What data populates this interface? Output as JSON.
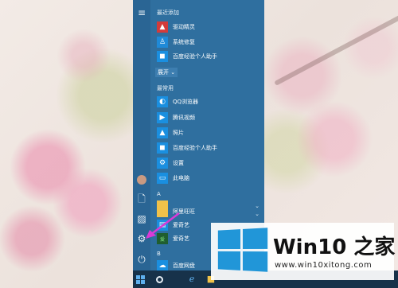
{
  "start_menu": {
    "recent_header": "最近添加",
    "recent_apps": [
      {
        "label": "驱动精灵",
        "icon": "driver-genius-icon",
        "color": "#d33b3b"
      },
      {
        "label": "系统修复",
        "icon": "system-repair-icon",
        "color": "#1f8ad8"
      },
      {
        "label": "百度经验个人助手",
        "icon": "baidu-assistant-icon",
        "color": "#1a8fe0"
      }
    ],
    "expand_label": "展开",
    "frequent_header": "最常用",
    "frequent_apps": [
      {
        "label": "QQ浏览器",
        "icon": "qq-browser-icon",
        "color": "#1a8fe0"
      },
      {
        "label": "腾讯视频",
        "icon": "tencent-video-icon",
        "color": "#1a8fe0"
      },
      {
        "label": "照片",
        "icon": "photos-icon",
        "color": "#1a8fe0"
      },
      {
        "label": "百度经验个人助手",
        "icon": "baidu-assistant-icon",
        "color": "#1a8fe0"
      },
      {
        "label": "设置",
        "icon": "gear-icon",
        "color": "#1a8fe0"
      },
      {
        "label": "此电脑",
        "icon": "this-pc-icon",
        "color": "#1a8fe0"
      }
    ],
    "letter_a": "A",
    "alpha_apps": [
      {
        "label": "",
        "icon": "folder-icon",
        "color": "#f0c24a"
      },
      {
        "label": "阿里旺旺",
        "icon": "aliwangwang-icon",
        "color": "#f0c24a"
      },
      {
        "label": "爱奇艺",
        "icon": "iqiyi-icon",
        "color": "#1a8fe0"
      },
      {
        "label": "爱奇艺",
        "icon": "iqiyi-tv-icon",
        "color": "#1a8fe0"
      }
    ],
    "letter_b": "B",
    "last_app": {
      "label": "百度网盘",
      "icon": "baidu-netdisk-icon",
      "color": "#1a8fe0"
    }
  },
  "watermark": {
    "title": "Win10 之家",
    "url": "www.win10xitong.com"
  },
  "colors": {
    "menu_bg": "#2f6f9f",
    "taskbar_bg": "#17324a",
    "arrow": "#d93ad6",
    "brand_blue": "#2196d8"
  }
}
